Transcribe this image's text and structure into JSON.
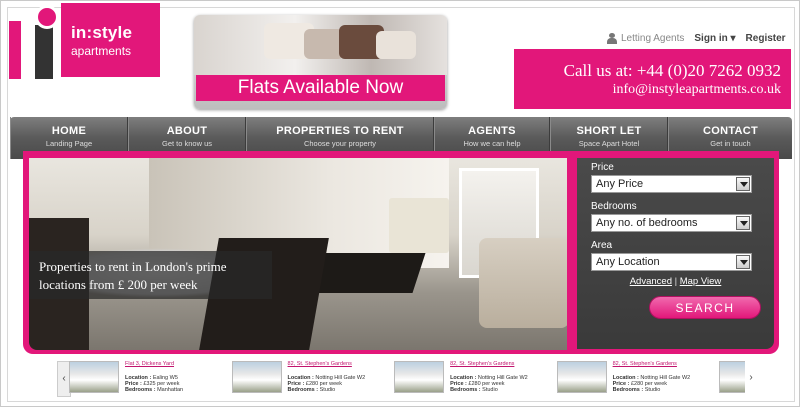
{
  "logo": {
    "line1": "in:style",
    "line2": "apartments"
  },
  "banner": {
    "caption": "Flats Available Now"
  },
  "top_links": {
    "agents": "Letting Agents",
    "signin": "Sign in",
    "register": "Register"
  },
  "contact": {
    "call": "Call us at: +44 (0)20 7262 0932",
    "email": "info@instyleapartments.co.uk"
  },
  "nav": [
    {
      "title": "HOME",
      "sub": "Landing Page"
    },
    {
      "title": "ABOUT",
      "sub": "Get to know us"
    },
    {
      "title": "PROPERTIES TO RENT",
      "sub": "Choose your property"
    },
    {
      "title": "AGENTS",
      "sub": "How we can help"
    },
    {
      "title": "SHORT LET",
      "sub": "Space Apart Hotel"
    },
    {
      "title": "CONTACT",
      "sub": "Get in touch"
    }
  ],
  "hero": {
    "caption_line1": "Properties to rent in London's prime",
    "caption_line2": "locations from £ 200 per week"
  },
  "search": {
    "price_label": "Price",
    "price_value": "Any Price",
    "bedrooms_label": "Bedrooms",
    "bedrooms_value": "Any no. of bedrooms",
    "area_label": "Area",
    "area_value": "Any Location",
    "advanced": "Advanced",
    "separator": "|",
    "map": "Map View",
    "button": "SEARCH"
  },
  "listings": [
    {
      "title": "Flat 3, Dickens Yard",
      "location": "Ealing W5",
      "price": "£325 per week",
      "bedrooms": "Manhattan"
    },
    {
      "title": "82, St. Stephen's Gardens",
      "location": "Notting Hill Gate W2",
      "price": "£280 per week",
      "bedrooms": "Studio"
    },
    {
      "title": "82, St. Stephen's Gardens",
      "location": "Notting Hill Gate W2",
      "price": "£280 per week",
      "bedrooms": "Studio"
    },
    {
      "title": "82, St. Stephen's Gardens",
      "location": "Notting Hill Gate W2",
      "price": "£280 per week",
      "bedrooms": "Studio"
    }
  ],
  "listing_labels": {
    "location": "Location :",
    "price": "Price :",
    "bedrooms": "Bedrooms :"
  },
  "arrows": {
    "prev": "‹",
    "next": "›"
  },
  "colors": {
    "brand_pink": "#e2177a",
    "nav_gray": "#5a5a5a",
    "panel_dark": "#3f3f3f"
  }
}
